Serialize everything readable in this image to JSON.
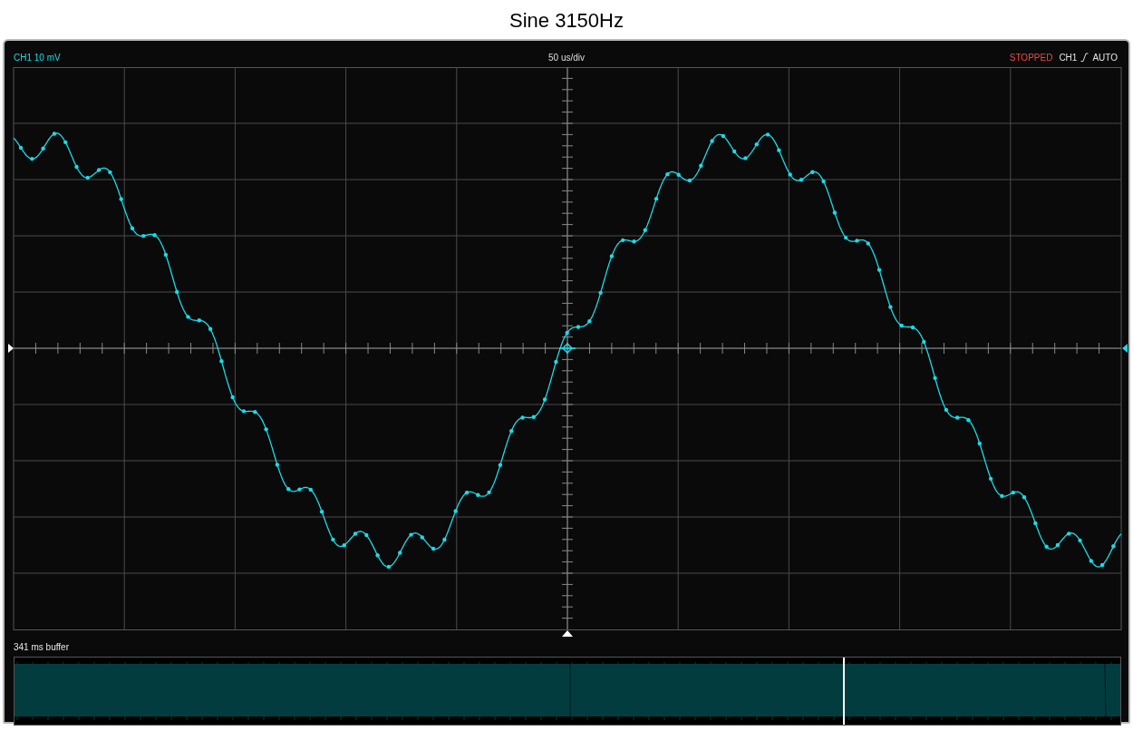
{
  "title": "Sine 3150Hz",
  "scope": {
    "channel_scale": "CH1 10 mV",
    "timebase": "50 us/div",
    "status": "STOPPED",
    "trigger_source": "CH1",
    "trigger_mode": "AUTO"
  },
  "buffer": {
    "label": "341 ms buffer"
  }
}
